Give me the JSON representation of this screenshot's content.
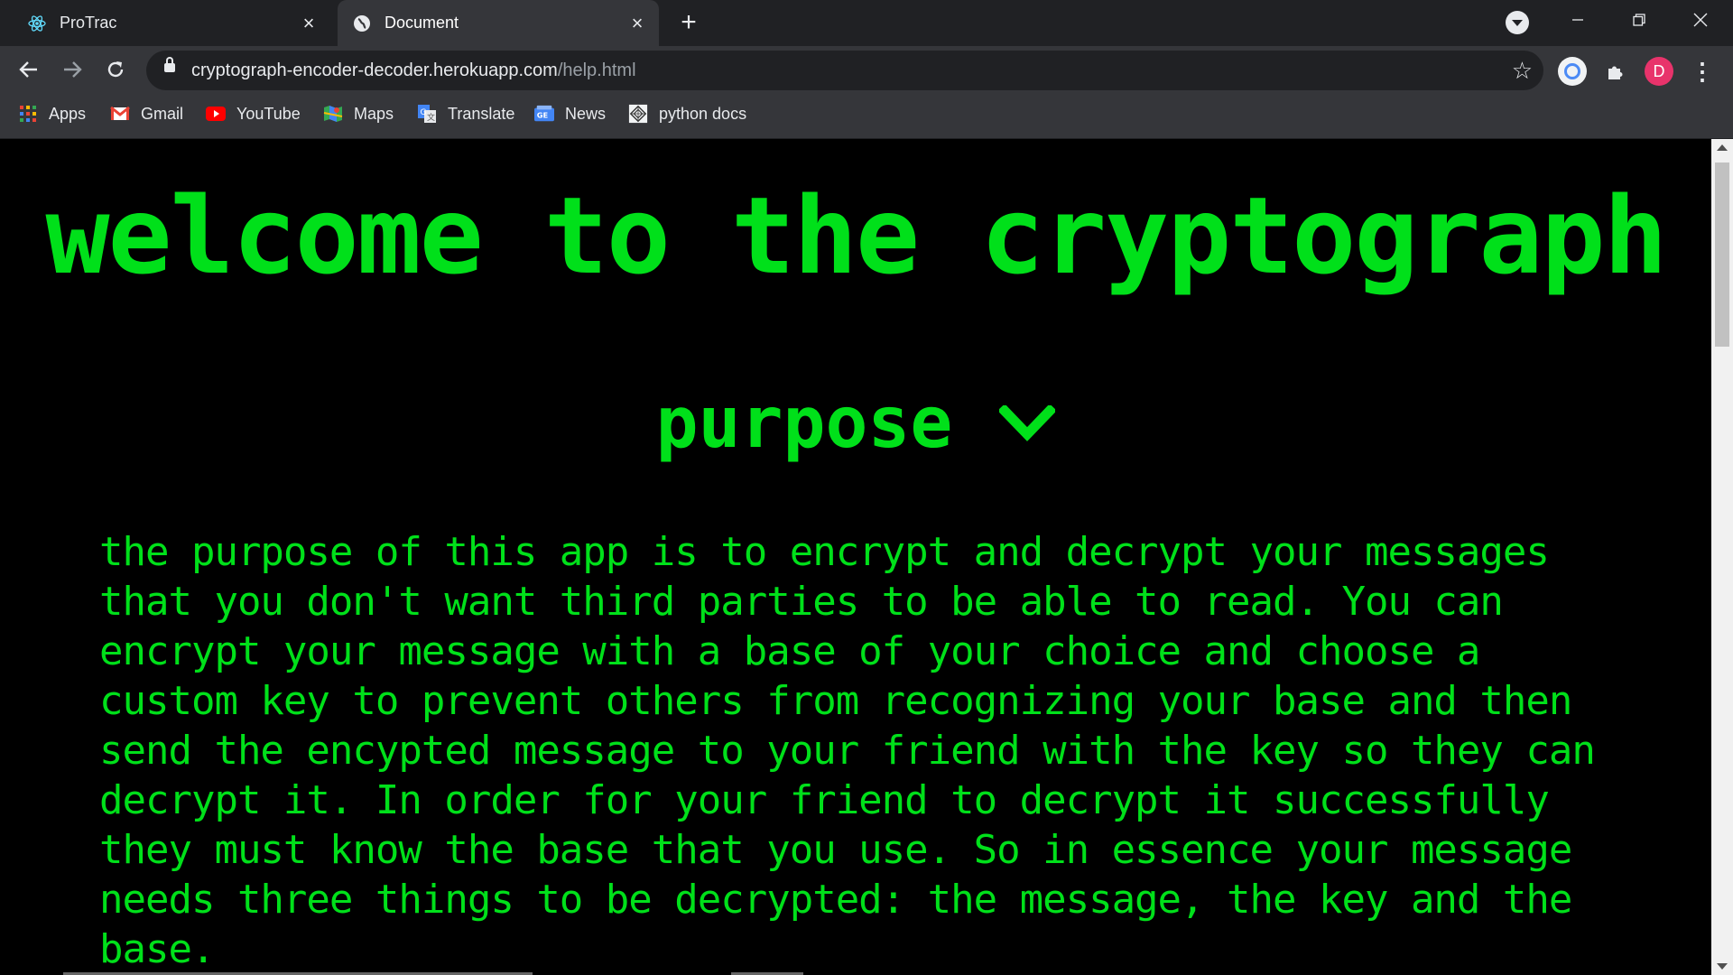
{
  "tabs": [
    {
      "label": "ProTrac",
      "icon": "react-icon",
      "active": false
    },
    {
      "label": "Document",
      "icon": "globe-icon",
      "active": true
    }
  ],
  "address_bar": {
    "domain": "cryptograph-encoder-decoder.herokuapp.com",
    "path": "/help.html"
  },
  "profile": {
    "initial": "D",
    "color": "#e8336b"
  },
  "bookmarks": [
    {
      "label": "Apps",
      "icon": "apps-grid-icon"
    },
    {
      "label": "Gmail",
      "icon": "gmail-icon"
    },
    {
      "label": "YouTube",
      "icon": "youtube-icon"
    },
    {
      "label": "Maps",
      "icon": "maps-icon"
    },
    {
      "label": "Translate",
      "icon": "translate-icon"
    },
    {
      "label": "News",
      "icon": "news-icon"
    },
    {
      "label": "python docs",
      "icon": "python-docs-icon"
    }
  ],
  "page": {
    "heading": "welcome to the cryptograph",
    "section_title": "purpose",
    "section_body": "the purpose of this app is to encrypt and decrypt your messages that you don't want third parties to be able to read. You can encrypt your message with a base of your choice and choose a custom key to prevent others from recognizing your base and then send the encypted message to your friend with the key so they can decrypt it. In order for your friend to decrypt it successfully they must know the base that you use. So in essence your message needs three things to be decrypted: the message, the key and the base.",
    "text_color": "#00e01a",
    "background_color": "#000000"
  }
}
